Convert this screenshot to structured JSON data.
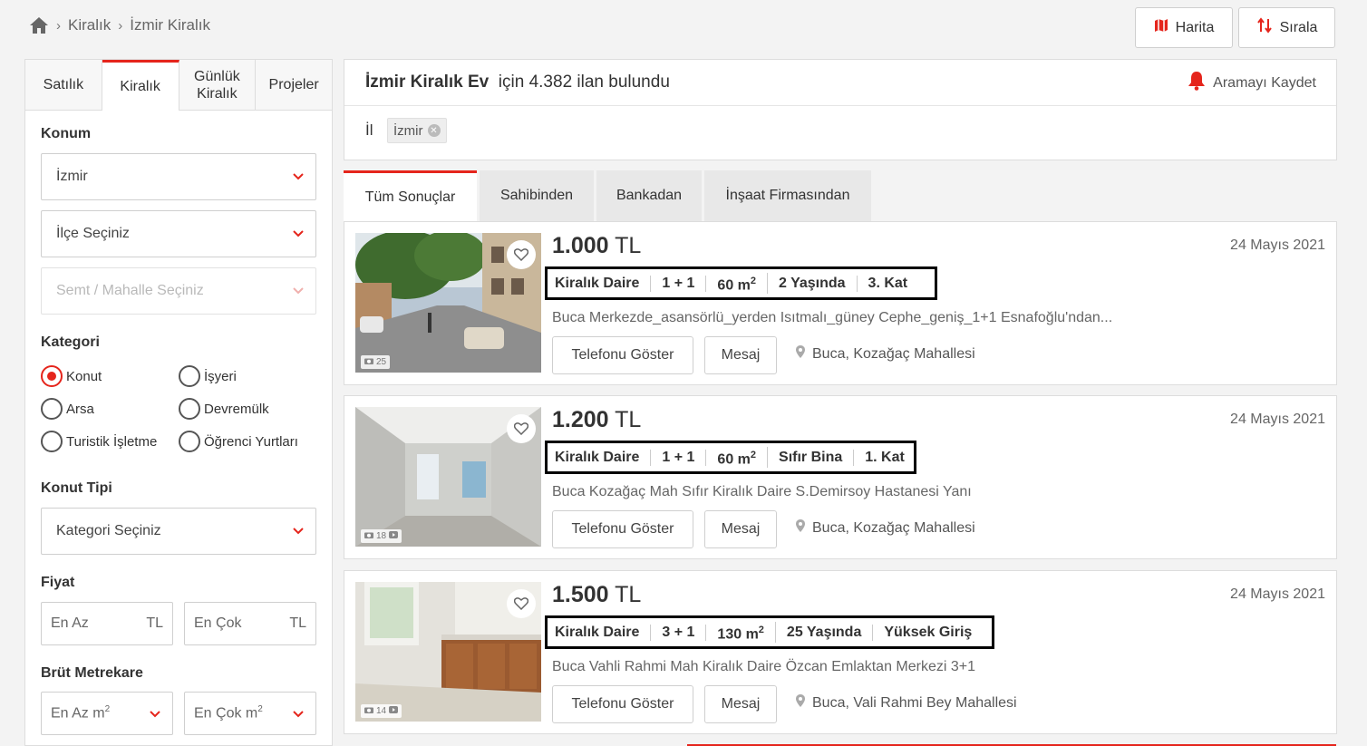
{
  "breadcrumb": {
    "items": [
      "Kiralık",
      "İzmir Kiralık"
    ]
  },
  "top_buttons": {
    "map_label": "Harita",
    "sort_label": "Sırala"
  },
  "sidebar": {
    "tabs": [
      {
        "label": "Satılık",
        "active": false
      },
      {
        "label": "Kiralık",
        "active": true
      },
      {
        "label": "Günlük Kiralık",
        "active": false
      },
      {
        "label": "Projeler",
        "active": false
      }
    ],
    "location_label": "Konum",
    "city_value": "İzmir",
    "district_placeholder": "İlçe Seçiniz",
    "neighborhood_placeholder": "Semt / Mahalle Seçiniz",
    "category_label": "Kategori",
    "categories": [
      {
        "label": "Konut",
        "checked": true
      },
      {
        "label": "İşyeri",
        "checked": false
      },
      {
        "label": "Arsa",
        "checked": false
      },
      {
        "label": "Devremülk",
        "checked": false
      },
      {
        "label": "Turistik İşletme",
        "checked": false
      },
      {
        "label": "Öğrenci Yurtları",
        "checked": false
      }
    ],
    "housing_type_label": "Konut Tipi",
    "housing_type_placeholder": "Kategori Seçiniz",
    "price_label": "Fiyat",
    "price_min_placeholder": "En Az",
    "price_max_placeholder": "En Çok",
    "currency": "TL",
    "area_label": "Brüt Metrekare",
    "area_min_placeholder": "En Az m",
    "area_max_placeholder": "En Çok m",
    "area_sup": "2"
  },
  "results": {
    "query_bold": "İzmir Kiralık Ev",
    "count_text": "için 4.382 ilan bulundu",
    "save_search_label": "Aramayı Kaydet",
    "filter_label": "İl",
    "filter_chip": "İzmir"
  },
  "result_tabs": [
    {
      "label": "Tüm Sonuçlar",
      "active": true
    },
    {
      "label": "Sahibinden",
      "active": false
    },
    {
      "label": "Bankadan",
      "active": false
    },
    {
      "label": "İnşaat Firmasından",
      "active": false
    }
  ],
  "listings": [
    {
      "price_value": "1.000",
      "currency": "TL",
      "date": "24 Mayıs 2021",
      "type": "Kiralık Daire",
      "rooms": "1 + 1",
      "area": "60 m",
      "area_sup": "2",
      "age": "2 Yaşında",
      "floor": "3. Kat",
      "description": "Buca Merkezde_asansörlü_yerden Isıtmalı_güney Cephe_geniş_1+1 Esnafoğlu'ndan...",
      "photo_count": "25",
      "has_video": false,
      "phone_label": "Telefonu Göster",
      "message_label": "Mesaj",
      "location": "Buca, Kozağaç Mahallesi"
    },
    {
      "price_value": "1.200",
      "currency": "TL",
      "date": "24 Mayıs 2021",
      "type": "Kiralık Daire",
      "rooms": "1 + 1",
      "area": "60 m",
      "area_sup": "2",
      "age": "Sıfır Bina",
      "floor": "1. Kat",
      "description": "Buca Kozağaç Mah Sıfır Kiralık Daire S.Demirsoy Hastanesi Yanı",
      "photo_count": "18",
      "has_video": true,
      "phone_label": "Telefonu Göster",
      "message_label": "Mesaj",
      "location": "Buca, Kozağaç Mahallesi"
    },
    {
      "price_value": "1.500",
      "currency": "TL",
      "date": "24 Mayıs 2021",
      "type": "Kiralık Daire",
      "rooms": "3 + 1",
      "area": "130 m",
      "area_sup": "2",
      "age": "25 Yaşında",
      "floor": "Yüksek Giriş",
      "description": "Buca Vahli Rahmi Mah Kiralık Daire Özcan Emlaktan Merkezi 3+1",
      "photo_count": "14",
      "has_video": true,
      "phone_label": "Telefonu Göster",
      "message_label": "Mesaj",
      "location": "Buca, Vali Rahmi Bey Mahallesi"
    }
  ],
  "colors": {
    "accent": "#e5251c",
    "highlight_border": "#000000"
  }
}
